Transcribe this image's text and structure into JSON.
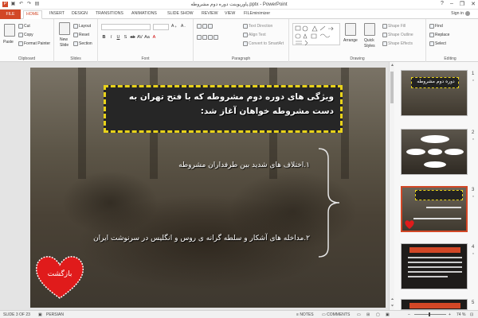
{
  "window": {
    "title": "پاورپوینت دوره دوم مشروطه.pptx - PowerPoint",
    "controls": [
      "?",
      "–",
      "❐",
      "✕"
    ]
  },
  "qat_icons": [
    "powerpoint-logo-icon",
    "save-icon",
    "undo-icon",
    "redo-icon",
    "present-icon"
  ],
  "tabs": [
    {
      "label": "FILE",
      "kind": "file"
    },
    {
      "label": "HOME",
      "kind": "active"
    },
    {
      "label": "INSERT"
    },
    {
      "label": "DESIGN"
    },
    {
      "label": "TRANSITIONS"
    },
    {
      "label": "ANIMATIONS"
    },
    {
      "label": "SLIDE SHOW"
    },
    {
      "label": "REVIEW"
    },
    {
      "label": "VIEW"
    },
    {
      "label": "FILEminimizer"
    }
  ],
  "signin": "Sign in",
  "ribbon": {
    "clipboard": {
      "paste": "Paste",
      "cut": "Cut",
      "copy": "Copy",
      "format_painter": "Format Painter",
      "label": "Clipboard"
    },
    "slides": {
      "new_slide_1": "New",
      "new_slide_2": "Slide",
      "layout": "Layout",
      "reset": "Reset",
      "section": "Section",
      "label": "Slides"
    },
    "font": {
      "label": "Font",
      "format_buttons": [
        "B",
        "I",
        "U",
        "S",
        "ab",
        "AV",
        "Aa",
        "A"
      ]
    },
    "paragraph": {
      "text_direction": "Text Direction",
      "align_text": "Align Text",
      "convert_smartart": "Convert to SmartArt",
      "label": "Paragraph"
    },
    "drawing": {
      "arrange": "Arrange",
      "quick_styles_1": "Quick",
      "quick_styles_2": "Styles",
      "shape_fill": "Shape Fill",
      "shape_outline": "Shape Outline",
      "shape_effects": "Shape Effects",
      "label": "Drawing"
    },
    "editing": {
      "find": "Find",
      "replace": "Replace",
      "select": "Select",
      "label": "Editing"
    }
  },
  "slide": {
    "title": "ویژگی های دوره دوم مشروطه که با فتح تهران به دست مشروطه خواهان آغاز شد:",
    "point1": "۱.اختلاف های شدید بین طرفداران مشروطه",
    "point2": "۲.مداخله های آشکار و سلطه گرانه ی روس و انگلیس در سرنوشت ایران",
    "back_button": "بازگشت",
    "colors": {
      "title_bg": "#262626",
      "title_border": "#e8d21a",
      "heart": "#e01b1b"
    }
  },
  "thumbnails": [
    {
      "num": "1",
      "caption": "دوره دوم مشروطه",
      "star": "*"
    },
    {
      "num": "2",
      "caption": "",
      "star": "*"
    },
    {
      "num": "3",
      "caption": "",
      "star": "*"
    },
    {
      "num": "4",
      "caption": "",
      "star": "*"
    },
    {
      "num": "5",
      "caption": "",
      "star": "*"
    }
  ],
  "status": {
    "slide": "SLIDE 3 OF 23",
    "language": "PERSIAN",
    "notes": "NOTES",
    "comments": "COMMENTS",
    "zoom": "74 %"
  },
  "accent": "#d24726"
}
